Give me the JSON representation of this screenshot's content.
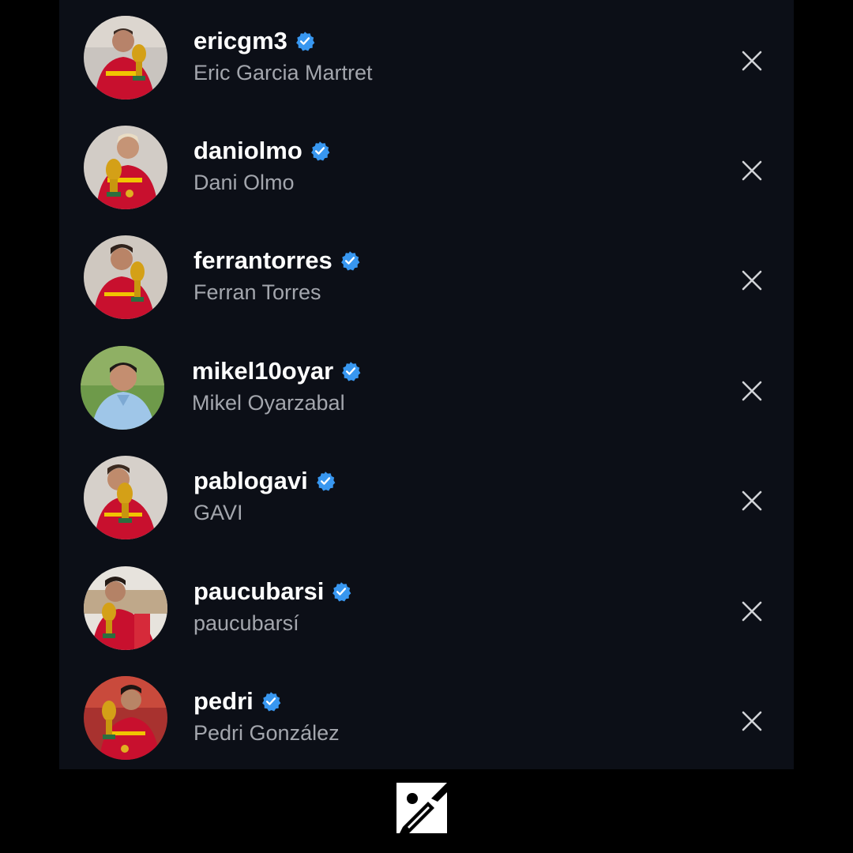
{
  "colors": {
    "background": "#000000",
    "panel": "#0c0f17",
    "username": "#ffffff",
    "fullname": "#a3a6ad",
    "verified_badge": "#3897f0",
    "remove_icon": "#d0d2d6"
  },
  "accounts": [
    {
      "username": "ericgm3",
      "full_name": "Eric Garcia Martret",
      "verified": true,
      "avatar": "player-with-trophy-red-jersey"
    },
    {
      "username": "daniolmo",
      "full_name": "Dani Olmo",
      "verified": true,
      "avatar": "player-with-trophy-red-jersey"
    },
    {
      "username": "ferrantorres",
      "full_name": "Ferran Torres",
      "verified": true,
      "avatar": "player-with-trophy-red-jersey"
    },
    {
      "username": "mikel10oyar",
      "full_name": "Mikel Oyarzabal",
      "verified": true,
      "avatar": "player-light-blue-jacket"
    },
    {
      "username": "pablogavi",
      "full_name": "GAVI",
      "verified": true,
      "avatar": "player-with-trophy-red-jersey"
    },
    {
      "username": "paucubarsi",
      "full_name": "paucubarsí",
      "verified": true,
      "avatar": "player-with-trophy-red-jersey"
    },
    {
      "username": "pedri",
      "full_name": "Pedri González",
      "verified": true,
      "avatar": "player-with-trophy-red-jersey"
    }
  ],
  "icons": {
    "verified": "verified-badge-icon",
    "remove": "close-icon",
    "logo": "image-edit-logo-icon"
  }
}
